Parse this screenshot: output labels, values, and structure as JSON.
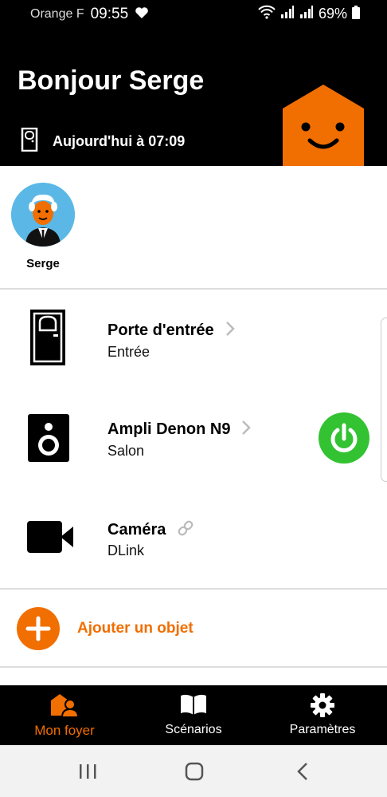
{
  "status_bar": {
    "carrier": "Orange F",
    "time": "09:55",
    "battery": "69%"
  },
  "header": {
    "greeting": "Bonjour Serge",
    "last_event": "Aujourd'hui à 07:09"
  },
  "users": [
    {
      "name": "Serge"
    }
  ],
  "devices": [
    {
      "name": "Porte d'entrée",
      "room": "Entrée",
      "icon": "door-icon",
      "action": "chevron-right-icon"
    },
    {
      "name": "Ampli Denon N9",
      "room": "Salon",
      "icon": "speaker-icon",
      "action": "chevron-right-icon",
      "power": "on"
    },
    {
      "name": "Caméra",
      "room": "DLink",
      "icon": "video-camera-icon",
      "action": "link-icon"
    }
  ],
  "add_object": {
    "label": "Ajouter un objet"
  },
  "tabs": [
    {
      "label": "Mon foyer",
      "icon": "home-people-icon",
      "active": true
    },
    {
      "label": "Scénarios",
      "icon": "book-icon",
      "active": false
    },
    {
      "label": "Paramètres",
      "icon": "gear-icon",
      "active": false
    }
  ],
  "colors": {
    "accent": "#f16e00",
    "power_on": "#32c232",
    "header_bg": "#000000"
  }
}
